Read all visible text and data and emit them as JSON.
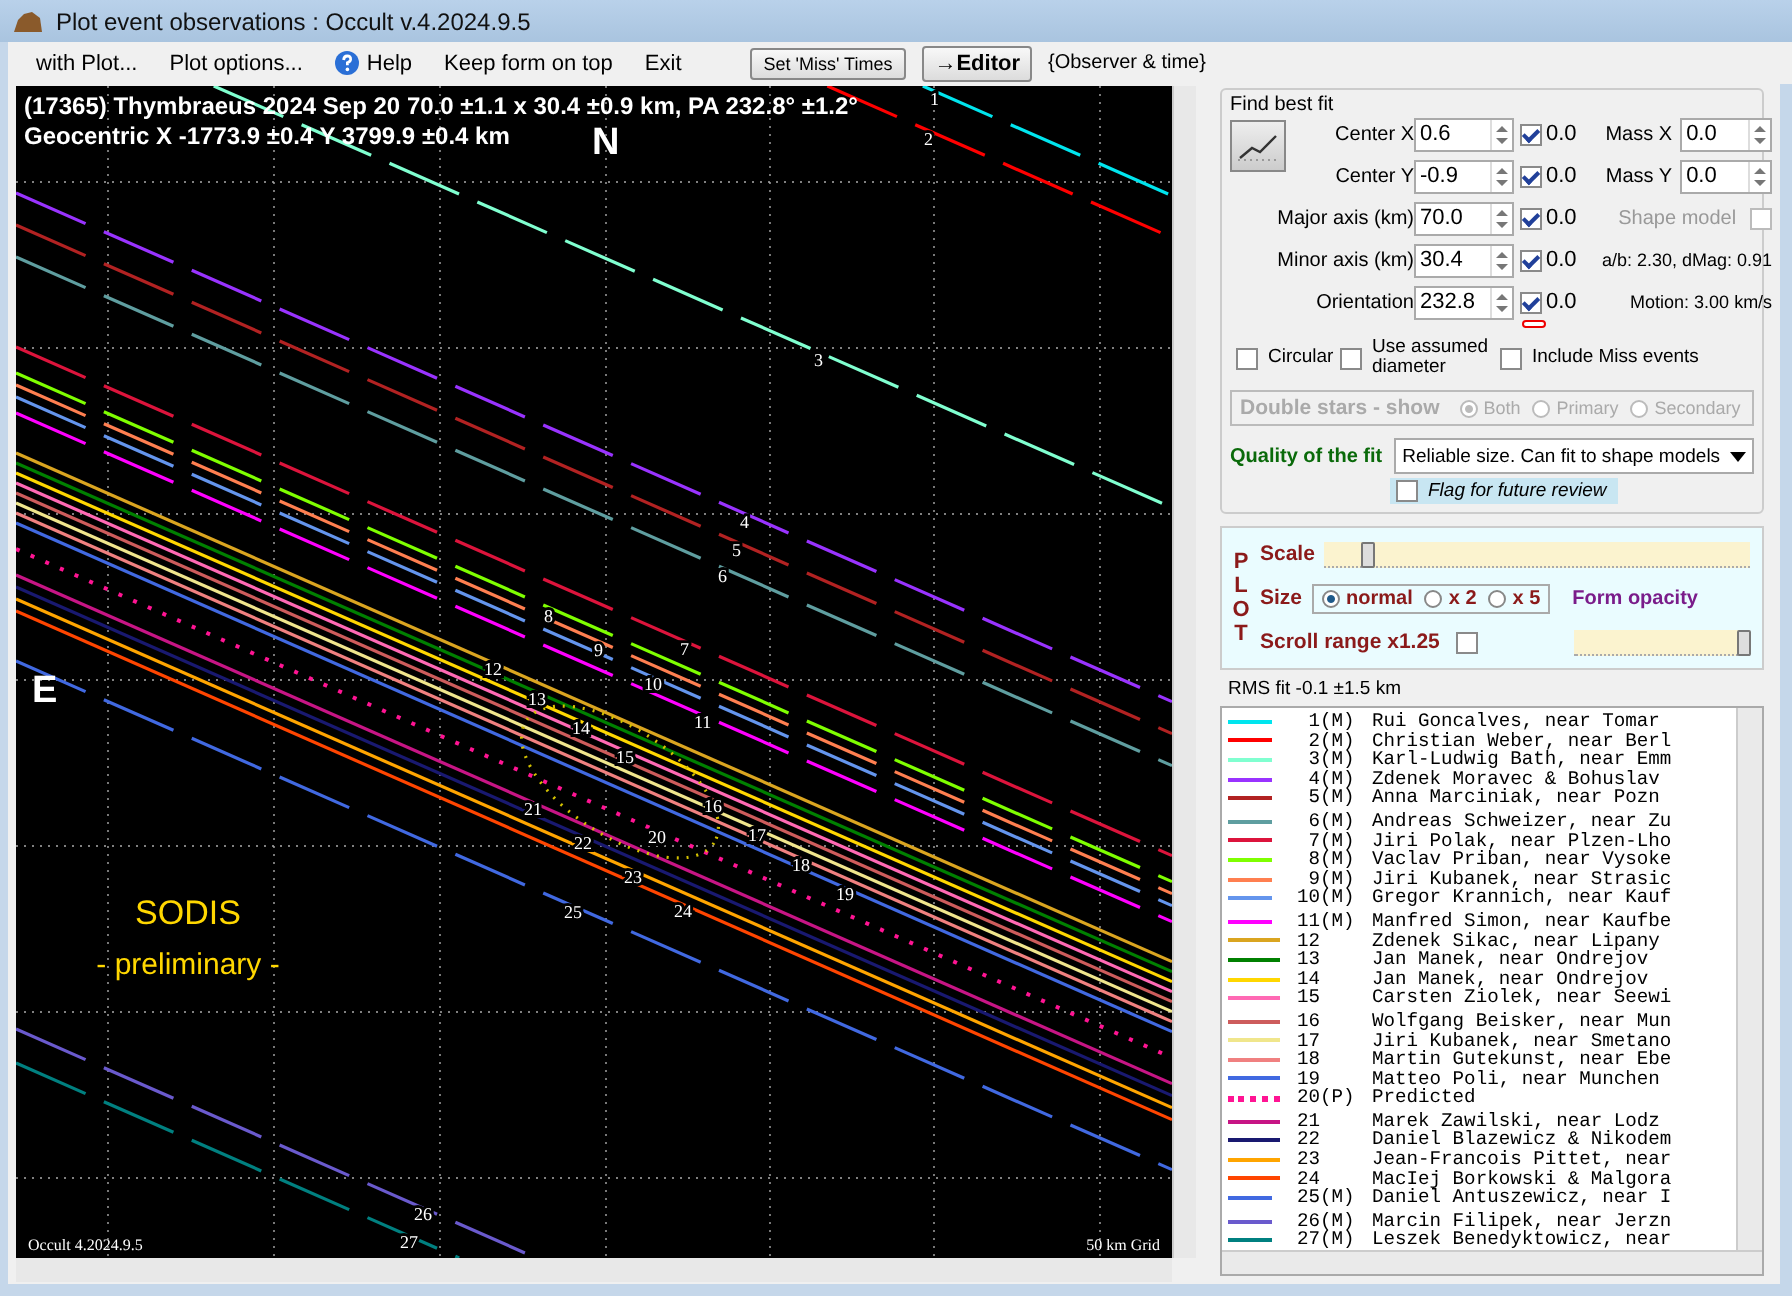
{
  "window": {
    "title": "Plot event observations : Occult v.4.2024.9.5"
  },
  "menu": {
    "items": [
      {
        "label": "with Plot...",
        "kind": "menu"
      },
      {
        "label": "Plot options...",
        "kind": "menu"
      },
      {
        "label": "Help",
        "kind": "help"
      },
      {
        "label": "Keep form on top",
        "kind": "menu"
      },
      {
        "label": "Exit",
        "kind": "menu"
      }
    ],
    "buttons": [
      {
        "label": "Set 'Miss' Times",
        "kind": "small"
      },
      {
        "label": "→Editor",
        "kind": "large"
      }
    ],
    "hint": "{Observer & time}"
  },
  "plot": {
    "header_line_1": "(17365) Thymbraeus  2024 Sep 20  70.0 ±1.1 x 30.4 ±0.9 km, PA 232.8° ±1.2°",
    "header_line_2": "Geocentric  X  -1773.9 ±0.4  Y 3799.9 ±0.4 km",
    "north_label": "N",
    "east_label": "E",
    "stamp_title": "SODIS",
    "stamp_subtitle": "- preliminary -",
    "footer_left": "Occult 4.2024.9.5",
    "footer_right": "50 km Grid"
  },
  "fit": {
    "title": "Find best fit",
    "params": [
      {
        "label": "Center X",
        "value": "0.6",
        "checked": true,
        "step": "0.0"
      },
      {
        "label": "Center Y",
        "value": "-0.9",
        "checked": true,
        "step": "0.0"
      },
      {
        "label": "Major axis (km)",
        "value": "70.0",
        "checked": true,
        "step": "0.0"
      },
      {
        "label": "Minor axis (km)",
        "value": "30.4",
        "checked": true,
        "step": "0.0"
      },
      {
        "label": "Orientation",
        "value": "232.8",
        "checked": true,
        "step": "0.0"
      }
    ],
    "mass": [
      {
        "label": "Mass X",
        "value": "0.0"
      },
      {
        "label": "Mass Y",
        "value": "0.0"
      }
    ],
    "shape_model": {
      "label": "Shape model",
      "checked": false
    },
    "ratio": "a/b: 2.30, dMag: 0.91",
    "motion": "Motion: 3.00 km/s",
    "options": [
      {
        "label": "Circular",
        "checked": false
      },
      {
        "label": "Use assumed diameter",
        "checked": false
      },
      {
        "label": "Include Miss events",
        "checked": false
      }
    ],
    "double_stars": {
      "label": "Double stars - show",
      "options": [
        {
          "label": "Both",
          "selected": true
        },
        {
          "label": "Primary",
          "selected": false
        },
        {
          "label": "Secondary",
          "selected": false
        }
      ]
    },
    "quality": {
      "label": "Quality of the fit",
      "value": "Reliable size. Can fit to shape models"
    },
    "flag": {
      "label": "Flag for future review",
      "checked": false
    }
  },
  "plot_settings": {
    "side_label": "PLOT",
    "scale": {
      "label": "Scale",
      "level": 0.1
    },
    "size": {
      "label": "Size",
      "options": [
        {
          "label": "normal",
          "selected": true
        },
        {
          "label": "x 2",
          "selected": false
        },
        {
          "label": "x 5",
          "selected": false
        }
      ]
    },
    "opacity": {
      "label": "Form opacity",
      "level": 0.97
    },
    "scroll_range": {
      "label": "Scroll range x1.25",
      "checked": false
    }
  },
  "rms": "RMS fit -0.1 ±1.5 km",
  "chords": [
    {
      "plot_label": "1",
      "number": "1",
      "tag": "(M)",
      "name": "Rui Goncalves, near Tomar",
      "color": "#00e5ee",
      "kind": "miss"
    },
    {
      "plot_label": "2",
      "number": "2",
      "tag": "(M)",
      "name": "Christian Weber, near Berl",
      "color": "#ff0000",
      "kind": "miss"
    },
    {
      "plot_label": "3",
      "number": "3",
      "tag": "(M)",
      "name": "Karl-Ludwig Bath, near Emm",
      "color": "#80ffd0",
      "kind": "miss"
    },
    {
      "plot_label": "4",
      "number": "4",
      "tag": "(M)",
      "name": "Zdenek Moravec & Bohuslav",
      "color": "#9933ff",
      "kind": "miss"
    },
    {
      "plot_label": "5",
      "number": "5",
      "tag": "(M)",
      "name": "Anna Marciniak, near Pozn",
      "color": "#b22222",
      "kind": "miss"
    },
    {
      "plot_label": "6",
      "number": "6",
      "tag": "(M)",
      "name": "Andreas Schweizer, near Zu",
      "color": "#5f9ea0",
      "kind": "miss"
    },
    {
      "plot_label": "7",
      "number": "7",
      "tag": "(M)",
      "name": "Jiri Polak, near Plzen-Lho",
      "color": "#dc143c",
      "kind": "miss"
    },
    {
      "plot_label": "8",
      "number": "8",
      "tag": "(M)",
      "name": "Vaclav Priban, near Vysoke",
      "color": "#7fff00",
      "kind": "miss"
    },
    {
      "plot_label": "9",
      "number": "9",
      "tag": "(M)",
      "name": "Jiri Kubanek, near Strasic",
      "color": "#ff7f50",
      "kind": "miss"
    },
    {
      "plot_label": "10",
      "number": "10",
      "tag": "(M)",
      "name": "Gregor Krannich, near Kauf",
      "color": "#6495ed",
      "kind": "miss"
    },
    {
      "plot_label": "11",
      "number": "11",
      "tag": "(M)",
      "name": "Manfred Simon, near Kaufbe",
      "color": "#ff00ff",
      "kind": "miss"
    },
    {
      "plot_label": "12",
      "number": "12",
      "name": "Zdenek Sikac, near Lipany",
      "color": "#daa520",
      "kind": "positive"
    },
    {
      "plot_label": "13",
      "number": "13",
      "name": "Jan Manek, near Ondrejov",
      "color": "#008000",
      "kind": "positive"
    },
    {
      "plot_label": "14",
      "number": "14",
      "name": "Jan Manek, near Ondrejov",
      "color": "#ffd700",
      "kind": "positive"
    },
    {
      "plot_label": "15",
      "number": "15",
      "name": "Carsten Ziolek, near Seewi",
      "color": "#ff69b4",
      "kind": "positive"
    },
    {
      "plot_label": "16",
      "number": "16",
      "name": "Wolfgang Beisker, near Mun",
      "color": "#cd5c5c",
      "kind": "positive"
    },
    {
      "plot_label": "17",
      "number": "17",
      "name": "Jiri Kubanek, near Smetano",
      "color": "#f0e68c",
      "kind": "positive"
    },
    {
      "plot_label": "18",
      "number": "18",
      "name": "Martin Gutekunst, near Ebe",
      "color": "#f08080",
      "kind": "positive"
    },
    {
      "plot_label": "19",
      "number": "19",
      "name": "Matteo Poli, near Munchen",
      "color": "#4169e1",
      "kind": "positive"
    },
    {
      "plot_label": "20",
      "number": "20",
      "tag": "(P)",
      "name": "Predicted",
      "color": "#ff1493",
      "kind": "predicted"
    },
    {
      "plot_label": "21",
      "number": "21",
      "name": "Marek Zawilski, near Lodz",
      "color": "#c71585",
      "kind": "positive"
    },
    {
      "plot_label": "22",
      "number": "22",
      "name": "Daniel Blazewicz & Nikodem",
      "color": "#191970",
      "kind": "positive"
    },
    {
      "plot_label": "23",
      "number": "23",
      "name": "Jean-Francois Pittet, near",
      "color": "#ffa500",
      "kind": "positive"
    },
    {
      "plot_label": "24",
      "number": "24",
      "name": "MacIej Borkowski & Malgora",
      "color": "#ff4500",
      "kind": "positive"
    },
    {
      "plot_label": "25",
      "number": "25",
      "tag": "(M)",
      "name": "Daniel Antuszewicz, near I",
      "color": "#4169e1",
      "kind": "miss"
    },
    {
      "plot_label": "26",
      "number": "26",
      "tag": "(M)",
      "name": "Marcin Filipek, near Jerzn",
      "color": "#6a5acd",
      "kind": "miss"
    },
    {
      "plot_label": "27",
      "number": "27",
      "tag": "(M)",
      "name": "Leszek Benedyktowicz, near",
      "color": "#008080",
      "kind": "miss"
    }
  ]
}
